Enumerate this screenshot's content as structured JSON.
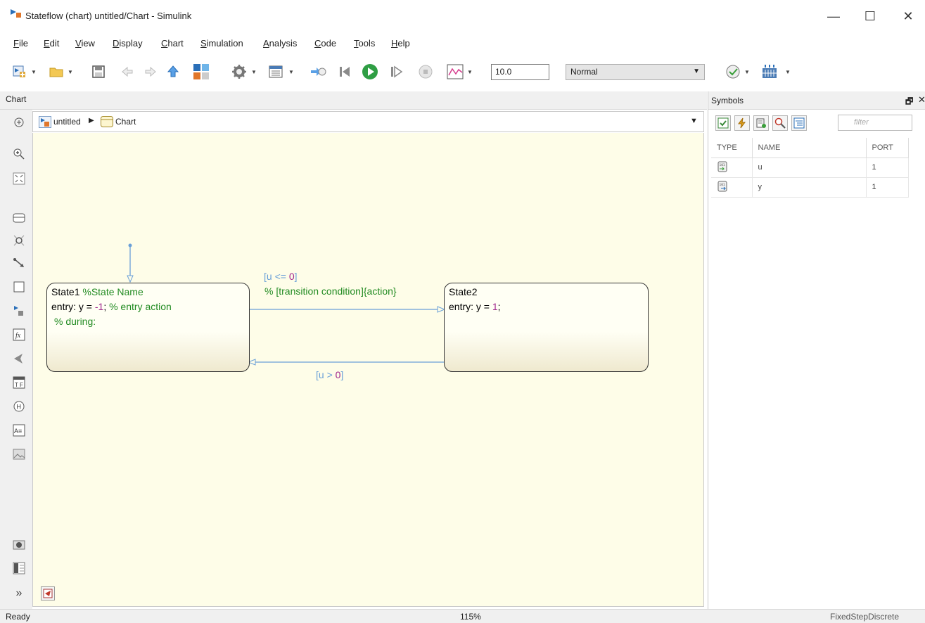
{
  "window": {
    "title": "Stateflow (chart) untitled/Chart - Simulink",
    "minimize": "—",
    "maximize": "☐",
    "close": "✕"
  },
  "menu": [
    "File",
    "Edit",
    "View",
    "Display",
    "Chart",
    "Simulation",
    "Analysis",
    "Code",
    "Tools",
    "Help"
  ],
  "toolbar": {
    "stop_time": "10.0",
    "sim_mode": "Normal"
  },
  "tabs": {
    "chart": "Chart"
  },
  "breadcrumb": {
    "model": "untitled",
    "chart": "Chart"
  },
  "chart": {
    "state1": {
      "name": "State1",
      "name_comment": "%State Name",
      "entry_prefix": "entry: y = ",
      "entry_value": "-1",
      "entry_suffix": ";",
      "entry_comment": "% entry action",
      "during_comment": "% during:"
    },
    "state2": {
      "name": "State2",
      "entry_prefix": "entry: y = ",
      "entry_value": "1",
      "entry_suffix": ";"
    },
    "transition_top": {
      "cond_open": "[u <= ",
      "cond_value": "0",
      "cond_close": "]",
      "comment": "% [transition condition]{action}"
    },
    "transition_bottom": {
      "cond_open": "[u > ",
      "cond_value": "0",
      "cond_close": "]"
    }
  },
  "symbols": {
    "title": "Symbols",
    "filter_placeholder": "filter",
    "columns": {
      "type": "TYPE",
      "name": "NAME",
      "port": "PORT"
    },
    "rows": [
      {
        "name": "u",
        "port": "1"
      },
      {
        "name": "y",
        "port": "1"
      }
    ]
  },
  "status": {
    "state": "Ready",
    "zoom": "115%",
    "solver": "FixedStepDiscrete"
  },
  "colors": {
    "canvas": "#fefde8",
    "comment": "#228b22",
    "number": "#a0268c",
    "transition": "#6aa0d8"
  }
}
